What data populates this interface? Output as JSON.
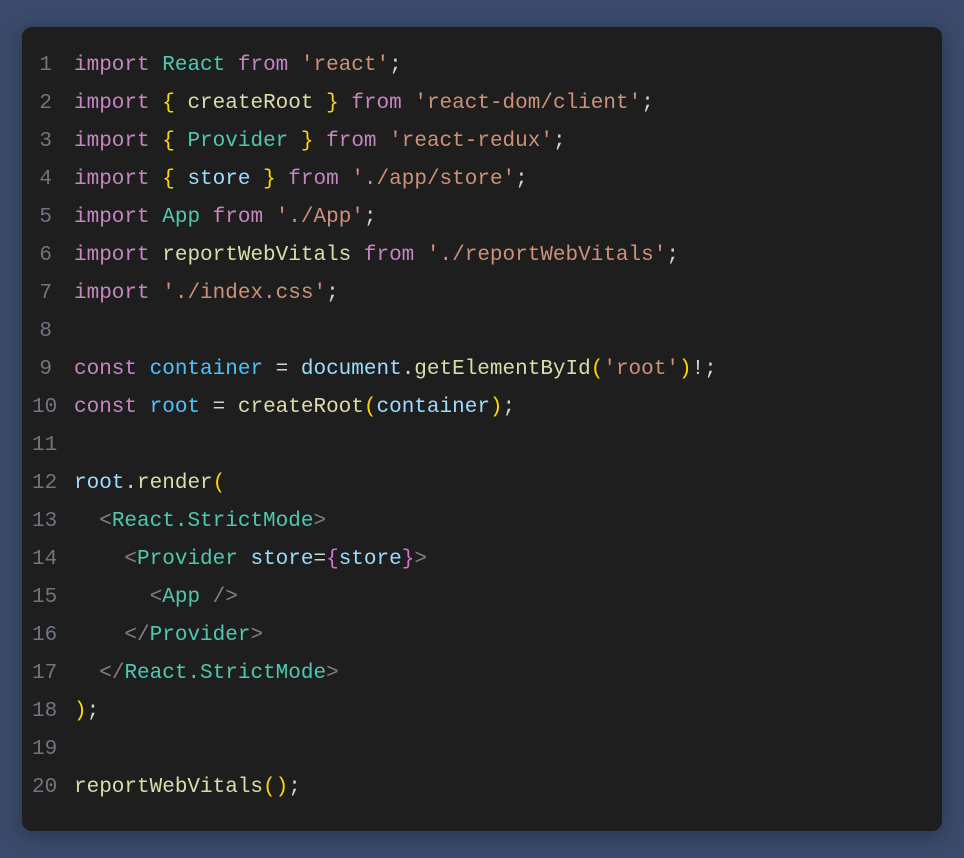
{
  "code": {
    "lines": [
      {
        "num": "1",
        "tokens": [
          {
            "t": "import",
            "c": "kw"
          },
          {
            "t": " ",
            "c": "punc"
          },
          {
            "t": "React",
            "c": "cls"
          },
          {
            "t": " ",
            "c": "punc"
          },
          {
            "t": "from",
            "c": "kw"
          },
          {
            "t": " ",
            "c": "punc"
          },
          {
            "t": "'react'",
            "c": "str"
          },
          {
            "t": ";",
            "c": "punc"
          }
        ]
      },
      {
        "num": "2",
        "tokens": [
          {
            "t": "import",
            "c": "kw"
          },
          {
            "t": " ",
            "c": "punc"
          },
          {
            "t": "{",
            "c": "brace"
          },
          {
            "t": " ",
            "c": "punc"
          },
          {
            "t": "createRoot",
            "c": "fn"
          },
          {
            "t": " ",
            "c": "punc"
          },
          {
            "t": "}",
            "c": "brace"
          },
          {
            "t": " ",
            "c": "punc"
          },
          {
            "t": "from",
            "c": "kw"
          },
          {
            "t": " ",
            "c": "punc"
          },
          {
            "t": "'react-dom/client'",
            "c": "str"
          },
          {
            "t": ";",
            "c": "punc"
          }
        ]
      },
      {
        "num": "3",
        "tokens": [
          {
            "t": "import",
            "c": "kw"
          },
          {
            "t": " ",
            "c": "punc"
          },
          {
            "t": "{",
            "c": "brace"
          },
          {
            "t": " ",
            "c": "punc"
          },
          {
            "t": "Provider",
            "c": "cls"
          },
          {
            "t": " ",
            "c": "punc"
          },
          {
            "t": "}",
            "c": "brace"
          },
          {
            "t": " ",
            "c": "punc"
          },
          {
            "t": "from",
            "c": "kw"
          },
          {
            "t": " ",
            "c": "punc"
          },
          {
            "t": "'react-redux'",
            "c": "str"
          },
          {
            "t": ";",
            "c": "punc"
          }
        ]
      },
      {
        "num": "4",
        "tokens": [
          {
            "t": "import",
            "c": "kw"
          },
          {
            "t": " ",
            "c": "punc"
          },
          {
            "t": "{",
            "c": "brace"
          },
          {
            "t": " ",
            "c": "punc"
          },
          {
            "t": "store",
            "c": "var"
          },
          {
            "t": " ",
            "c": "punc"
          },
          {
            "t": "}",
            "c": "brace"
          },
          {
            "t": " ",
            "c": "punc"
          },
          {
            "t": "from",
            "c": "kw"
          },
          {
            "t": " ",
            "c": "punc"
          },
          {
            "t": "'./app/store'",
            "c": "str"
          },
          {
            "t": ";",
            "c": "punc"
          }
        ]
      },
      {
        "num": "5",
        "tokens": [
          {
            "t": "import",
            "c": "kw"
          },
          {
            "t": " ",
            "c": "punc"
          },
          {
            "t": "App",
            "c": "cls"
          },
          {
            "t": " ",
            "c": "punc"
          },
          {
            "t": "from",
            "c": "kw"
          },
          {
            "t": " ",
            "c": "punc"
          },
          {
            "t": "'./App'",
            "c": "str"
          },
          {
            "t": ";",
            "c": "punc"
          }
        ]
      },
      {
        "num": "6",
        "tokens": [
          {
            "t": "import",
            "c": "kw"
          },
          {
            "t": " ",
            "c": "punc"
          },
          {
            "t": "reportWebVitals",
            "c": "fn"
          },
          {
            "t": " ",
            "c": "punc"
          },
          {
            "t": "from",
            "c": "kw"
          },
          {
            "t": " ",
            "c": "punc"
          },
          {
            "t": "'./reportWebVitals'",
            "c": "str"
          },
          {
            "t": ";",
            "c": "punc"
          }
        ]
      },
      {
        "num": "7",
        "tokens": [
          {
            "t": "import",
            "c": "kw"
          },
          {
            "t": " ",
            "c": "punc"
          },
          {
            "t": "'./index.css'",
            "c": "str"
          },
          {
            "t": ";",
            "c": "punc"
          }
        ]
      },
      {
        "num": "8",
        "tokens": []
      },
      {
        "num": "9",
        "tokens": [
          {
            "t": "const",
            "c": "kw"
          },
          {
            "t": " ",
            "c": "punc"
          },
          {
            "t": "container",
            "c": "const-name"
          },
          {
            "t": " = ",
            "c": "punc"
          },
          {
            "t": "document",
            "c": "var"
          },
          {
            "t": ".",
            "c": "punc"
          },
          {
            "t": "getElementById",
            "c": "fn"
          },
          {
            "t": "(",
            "c": "brace"
          },
          {
            "t": "'root'",
            "c": "str"
          },
          {
            "t": ")",
            "c": "brace"
          },
          {
            "t": "!;",
            "c": "punc"
          }
        ]
      },
      {
        "num": "10",
        "tokens": [
          {
            "t": "const",
            "c": "kw"
          },
          {
            "t": " ",
            "c": "punc"
          },
          {
            "t": "root",
            "c": "const-name"
          },
          {
            "t": " = ",
            "c": "punc"
          },
          {
            "t": "createRoot",
            "c": "fn"
          },
          {
            "t": "(",
            "c": "brace"
          },
          {
            "t": "container",
            "c": "var"
          },
          {
            "t": ")",
            "c": "brace"
          },
          {
            "t": ";",
            "c": "punc"
          }
        ]
      },
      {
        "num": "11",
        "tokens": []
      },
      {
        "num": "12",
        "tokens": [
          {
            "t": "root",
            "c": "var"
          },
          {
            "t": ".",
            "c": "punc"
          },
          {
            "t": "render",
            "c": "fn"
          },
          {
            "t": "(",
            "c": "brace"
          }
        ]
      },
      {
        "num": "13",
        "tokens": [
          {
            "t": "  ",
            "c": "punc"
          },
          {
            "t": "<",
            "c": "tag"
          },
          {
            "t": "React.StrictMode",
            "c": "component"
          },
          {
            "t": ">",
            "c": "tag"
          }
        ]
      },
      {
        "num": "14",
        "tokens": [
          {
            "t": "    ",
            "c": "punc"
          },
          {
            "t": "<",
            "c": "tag"
          },
          {
            "t": "Provider",
            "c": "component"
          },
          {
            "t": " ",
            "c": "punc"
          },
          {
            "t": "store",
            "c": "attr"
          },
          {
            "t": "=",
            "c": "punc"
          },
          {
            "t": "{",
            "c": "brace2"
          },
          {
            "t": "store",
            "c": "var"
          },
          {
            "t": "}",
            "c": "brace2"
          },
          {
            "t": ">",
            "c": "tag"
          }
        ]
      },
      {
        "num": "15",
        "tokens": [
          {
            "t": "      ",
            "c": "punc"
          },
          {
            "t": "<",
            "c": "tag"
          },
          {
            "t": "App",
            "c": "component"
          },
          {
            "t": " />",
            "c": "tag"
          }
        ]
      },
      {
        "num": "16",
        "tokens": [
          {
            "t": "    ",
            "c": "punc"
          },
          {
            "t": "</",
            "c": "tag"
          },
          {
            "t": "Provider",
            "c": "component"
          },
          {
            "t": ">",
            "c": "tag"
          }
        ]
      },
      {
        "num": "17",
        "tokens": [
          {
            "t": "  ",
            "c": "punc"
          },
          {
            "t": "</",
            "c": "tag"
          },
          {
            "t": "React.StrictMode",
            "c": "component"
          },
          {
            "t": ">",
            "c": "tag"
          }
        ]
      },
      {
        "num": "18",
        "tokens": [
          {
            "t": ")",
            "c": "brace"
          },
          {
            "t": ";",
            "c": "punc"
          }
        ]
      },
      {
        "num": "19",
        "tokens": []
      },
      {
        "num": "20",
        "tokens": [
          {
            "t": "reportWebVitals",
            "c": "fn"
          },
          {
            "t": "(",
            "c": "brace"
          },
          {
            "t": ")",
            "c": "brace"
          },
          {
            "t": ";",
            "c": "punc"
          }
        ]
      }
    ]
  }
}
